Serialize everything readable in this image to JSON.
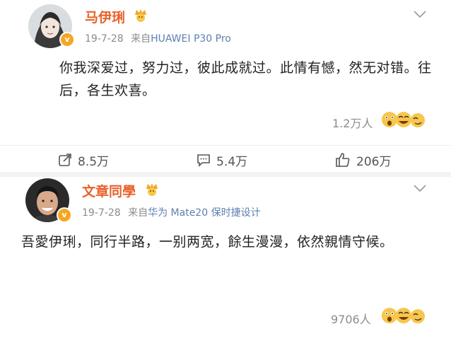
{
  "posts": [
    {
      "username": "马伊琍",
      "date": "19-7-28",
      "source_prefix": "来自",
      "source": "HUAWEI P30 Pro",
      "content": "你我深爱过，努力过，彼此成就过。此情有憾，然无对错。往后，各生欢喜。",
      "likes_text": "1.2万人",
      "actions": {
        "share": "8.5万",
        "comment": "5.4万",
        "like": "206万"
      },
      "avatar_icon": "female-avatar-icon",
      "verified_badge": "v-verified-icon",
      "member_icon": "weibo-member-icon"
    },
    {
      "username": "文章同學",
      "date": "19-7-28",
      "source_prefix": "来自",
      "source": "华为 Mate20 保时捷设计",
      "content": "吾愛伊琍，同行半路，一别两宽，餘生漫漫，依然親情守候。",
      "likes_text": "9706人",
      "avatar_icon": "male-avatar-icon",
      "verified_badge": "v-verified-icon",
      "member_icon": "weibo-member-icon"
    }
  ],
  "colors": {
    "username": "#e8622a",
    "source_link": "#5d7fb0",
    "meta_gray": "#8c8c8c",
    "verified_orange": "#f5a623"
  }
}
